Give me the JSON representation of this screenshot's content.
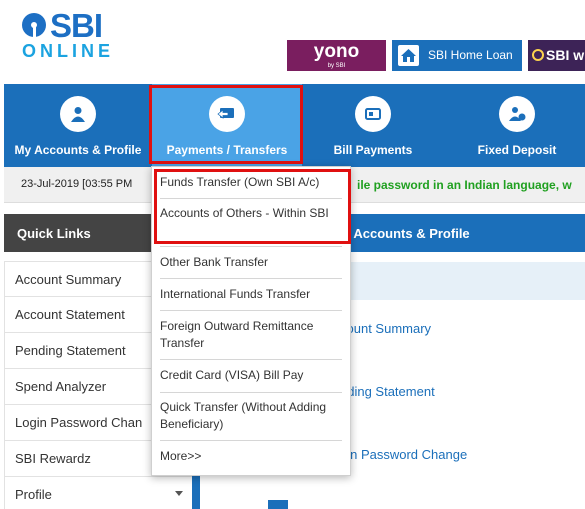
{
  "header": {
    "logo_sbi": "SBI",
    "logo_online": "ONLINE",
    "yono_label": "yono",
    "yono_sub": "by SBI",
    "homeloan_label": "SBI Home Loan",
    "sbiw_label": "SBI w"
  },
  "nav": {
    "items": [
      {
        "label": "My Accounts & Profile",
        "icon": "user-icon"
      },
      {
        "label": "Payments / Transfers",
        "icon": "transfer-icon",
        "active": true
      },
      {
        "label": "Bill Payments",
        "icon": "bill-icon"
      },
      {
        "label": "Fixed Deposit",
        "icon": "deposit-icon"
      }
    ]
  },
  "date_bar": {
    "date": "23-Jul-2019 [03:55 PM",
    "marquee": "ile password in an Indian language, w"
  },
  "dropdown": {
    "items": [
      "Funds Transfer (Own SBI A/c)",
      "Accounts of Others - Within SBI",
      "Other Bank Transfer",
      "International Funds Transfer",
      "Foreign Outward Remittance Transfer",
      "Credit Card (VISA) Bill Pay",
      "Quick Transfer (Without Adding Beneficiary)",
      "More>>"
    ]
  },
  "quick_links": {
    "title": "Quick Links",
    "items": [
      "Account Summary",
      "Account Statement",
      "Pending Statement",
      "Spend Analyzer",
      "Login Password Chan",
      "SBI Rewardz",
      "Profile"
    ]
  },
  "main": {
    "title": "y Accounts & Profile",
    "links": [
      "count Summary",
      "nding Statement",
      "gin Password Change"
    ]
  },
  "colors": {
    "brand_blue": "#1b6fba",
    "active_tab": "#4aa3e6",
    "highlight_red": "#e01010",
    "marquee_green": "#20a020",
    "yono_purple": "#7a1e5f"
  }
}
